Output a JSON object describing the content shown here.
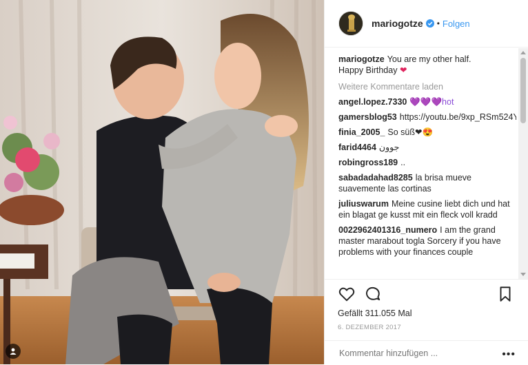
{
  "header": {
    "username": "mariogotze",
    "separator": "•",
    "follow_label": "Folgen"
  },
  "caption": {
    "user": "mariogotze",
    "text": "You are my other half.",
    "line2": "Happy Birthday",
    "heart": "❤"
  },
  "load_more": "Weitere Kommentare laden",
  "comments": [
    {
      "user": "angel.lopez.7330",
      "text": "💜💜💜hot"
    },
    {
      "user": "gamersblog53",
      "text": "https://youtu.be/9xp_RSm524Y"
    },
    {
      "user": "finia_2005_",
      "text": "So süß❤😍"
    },
    {
      "user": "farid4464",
      "text": "جوون"
    },
    {
      "user": "robingross189",
      "text": ".."
    },
    {
      "user": "sabadadahad8285",
      "text": "la brisa mueve suavemente las cortinas"
    },
    {
      "user": "juliuswarum",
      "text": "Meine cusine liebt dich und hat ein blagat ge kusst mit ein fleck voll kradd"
    },
    {
      "user": "0022962401316_numero",
      "text": "I am the grand master marabout togla Sorcery if you have problems with your finances couple"
    }
  ],
  "likes": "Gefällt 311.055 Mal",
  "date": "6. DEZEMBER 2017",
  "comment_placeholder": "Kommentar hinzufügen ...",
  "more_label": "•••",
  "colors": {
    "link": "#3897f0",
    "muted": "#999999",
    "text": "#262626"
  },
  "icons": {
    "like": "heart-outline-icon",
    "comment": "speech-bubble-icon",
    "save": "bookmark-icon",
    "verified": "verified-badge-icon",
    "tagged": "person-tag-icon"
  }
}
